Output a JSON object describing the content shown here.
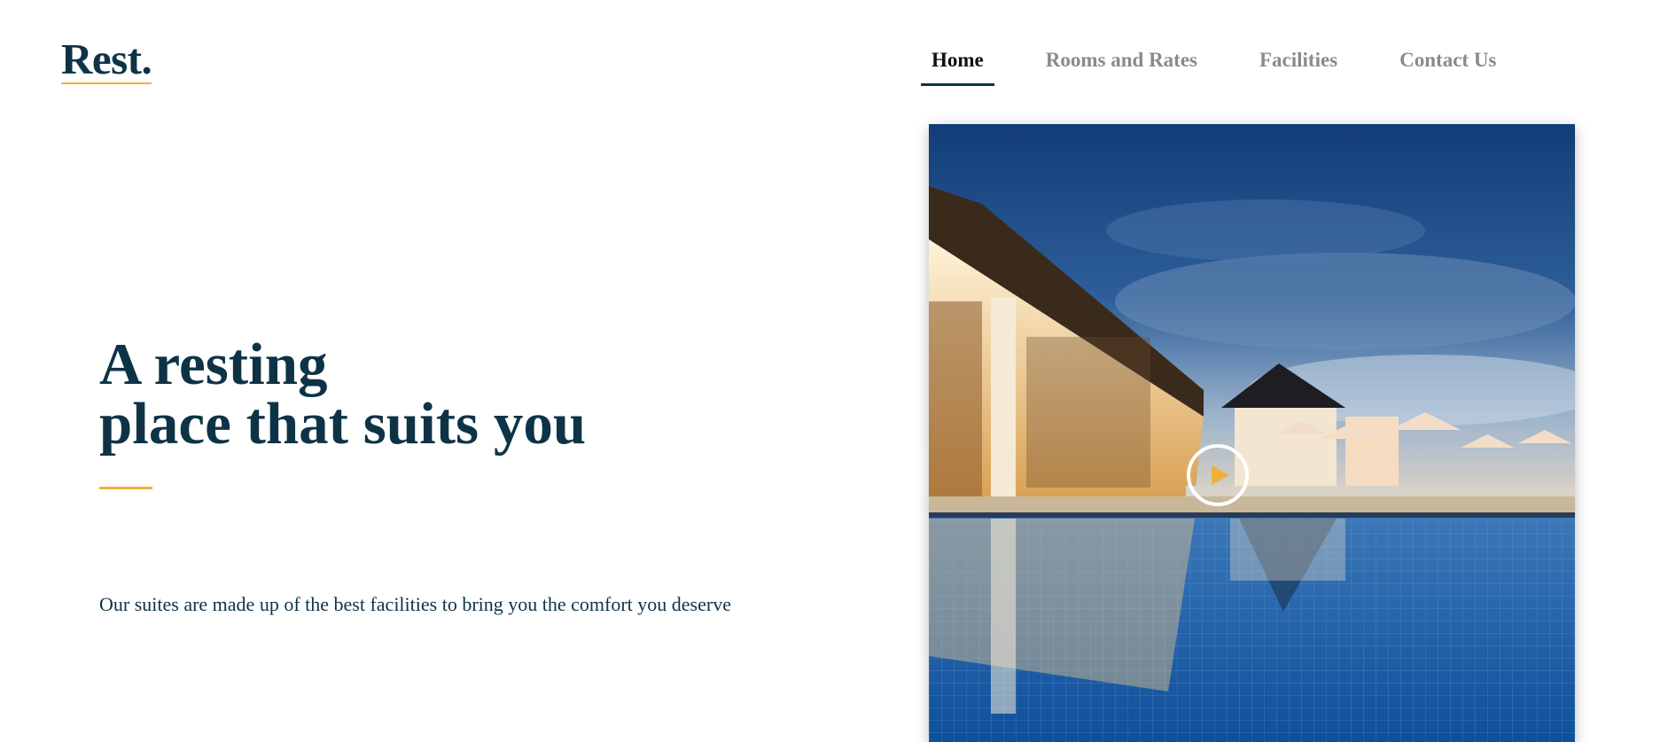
{
  "header": {
    "logo": "Rest.",
    "nav": [
      {
        "label": "Home",
        "active": true
      },
      {
        "label": "Rooms and Rates",
        "active": false
      },
      {
        "label": "Facilities",
        "active": false
      },
      {
        "label": "Contact Us",
        "active": false
      }
    ]
  },
  "hero": {
    "title_line1": "A resting",
    "title_line2": "place that suits you",
    "description": "Our suites are made up of the best facilities to bring you the comfort you deserve"
  },
  "media": {
    "play_icon": "play-icon"
  },
  "colors": {
    "brand": "#0e3347",
    "accent": "#f0b13a",
    "nav_inactive": "#8a8a8a"
  }
}
